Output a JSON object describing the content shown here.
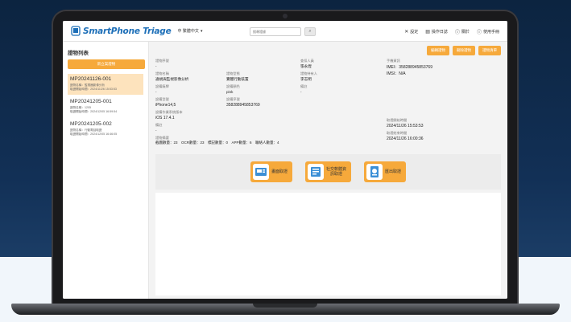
{
  "app": {
    "logo_text": "SmartPhone Triage",
    "language": "中 繁體中文"
  },
  "search": {
    "placeholder": "搜尋證據"
  },
  "top_menu": [
    {
      "icon": "tools-icon",
      "label": "設定"
    },
    {
      "icon": "log-icon",
      "label": "操作日誌"
    },
    {
      "icon": "info-icon",
      "label": "關於"
    },
    {
      "icon": "help-icon",
      "label": "使用手冊"
    }
  ],
  "sidebar": {
    "title": "證物列表",
    "add_button": "新立案證物",
    "items": [
      {
        "id": "MP20241126-001",
        "line1": "證物名稱：監視器影像分析",
        "line2": "取證開始時間：2024/11/26 15:53:53",
        "active": true
      },
      {
        "id": "MP20241205-001",
        "line1": "證物名稱：1205",
        "line2": "取證開始時間：2024/12/05 16:59:54",
        "active": false
      },
      {
        "id": "MP20241205-002",
        "line1": "證物名稱：行動電話取證",
        "line2": "取證開始時間：2024/12/05 16:46:05",
        "active": false
      }
    ]
  },
  "actions": [
    "編輯證物",
    "刪除證物",
    "證物清單"
  ],
  "details": {
    "col1": [
      {
        "label": "證物序號",
        "value": "-"
      },
      {
        "label": "證物名稱",
        "value": "違規與監視影像分析",
        "extra": ""
      },
      {
        "label": "設備廠牌",
        "value": "-"
      },
      {
        "label": "設備型號",
        "value": "iPhone14,5"
      },
      {
        "label": "設備作業系統版本",
        "value": "iOS 17.4.1"
      },
      {
        "label": "備註",
        "value": "-"
      }
    ],
    "col2": [
      {
        "label": "證物型態",
        "value": "實體行動裝置"
      },
      {
        "label": "設備顏色",
        "value": "pink"
      },
      {
        "label": "設備序號",
        "value": "358288945853769"
      }
    ],
    "col3": [
      {
        "label": "查扣人員",
        "value": "張永煌"
      },
      {
        "label": "證物持有人",
        "value": "李志明"
      },
      {
        "label": "備註",
        "value": "-"
      }
    ],
    "col4": [
      {
        "label": "手機資訊",
        "value": "IMEI：358288945853769"
      },
      {
        "label": "",
        "value": "IMSI：N/A"
      }
    ],
    "time_start_label": "取證開始時間",
    "time_start": "2024/11/26 15:53:53",
    "time_end_label": "取證結束時間",
    "time_end": "2024/11/26 16:00:36",
    "stats_label": "證物摘要",
    "stats": "截圖數量：23　OCR數量：23　標記數量：0　APP數量：6　聯絡人數量：4"
  },
  "tools": [
    {
      "icon": "screenshot-icon",
      "label": "畫面取證"
    },
    {
      "icon": "social-icon",
      "label": "社交軟體資\n訊取證"
    },
    {
      "icon": "report-icon",
      "label": "匯出取證"
    }
  ]
}
